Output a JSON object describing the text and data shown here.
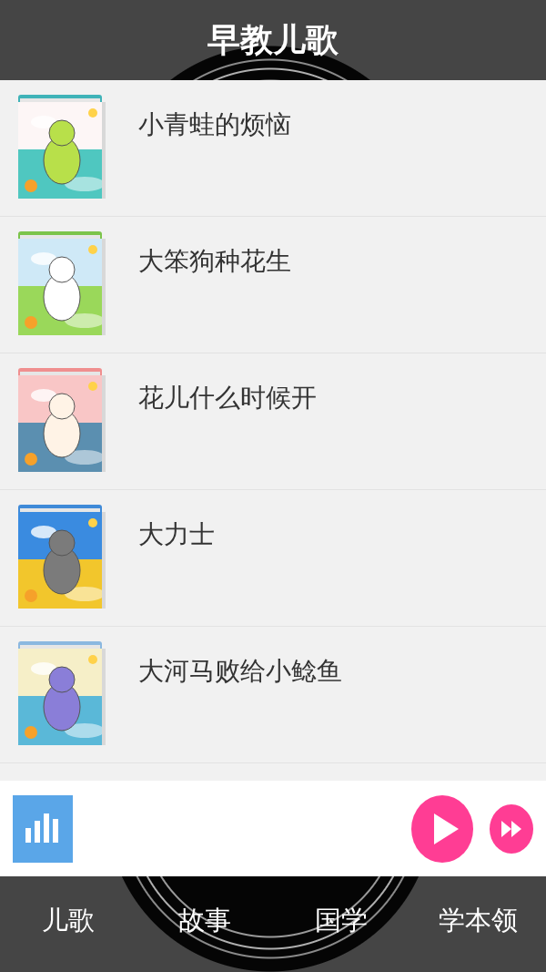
{
  "header": {
    "title": "早教儿歌"
  },
  "songs": [
    {
      "title": "小青蛙的烦恼"
    },
    {
      "title": "大笨狗种花生"
    },
    {
      "title": "花儿什么时候开"
    },
    {
      "title": "大力士"
    },
    {
      "title": "大河马败给小鲶鱼"
    }
  ],
  "nav": {
    "tabs": [
      {
        "label": "儿歌"
      },
      {
        "label": "故事"
      },
      {
        "label": "国学"
      },
      {
        "label": "学本领"
      }
    ]
  }
}
